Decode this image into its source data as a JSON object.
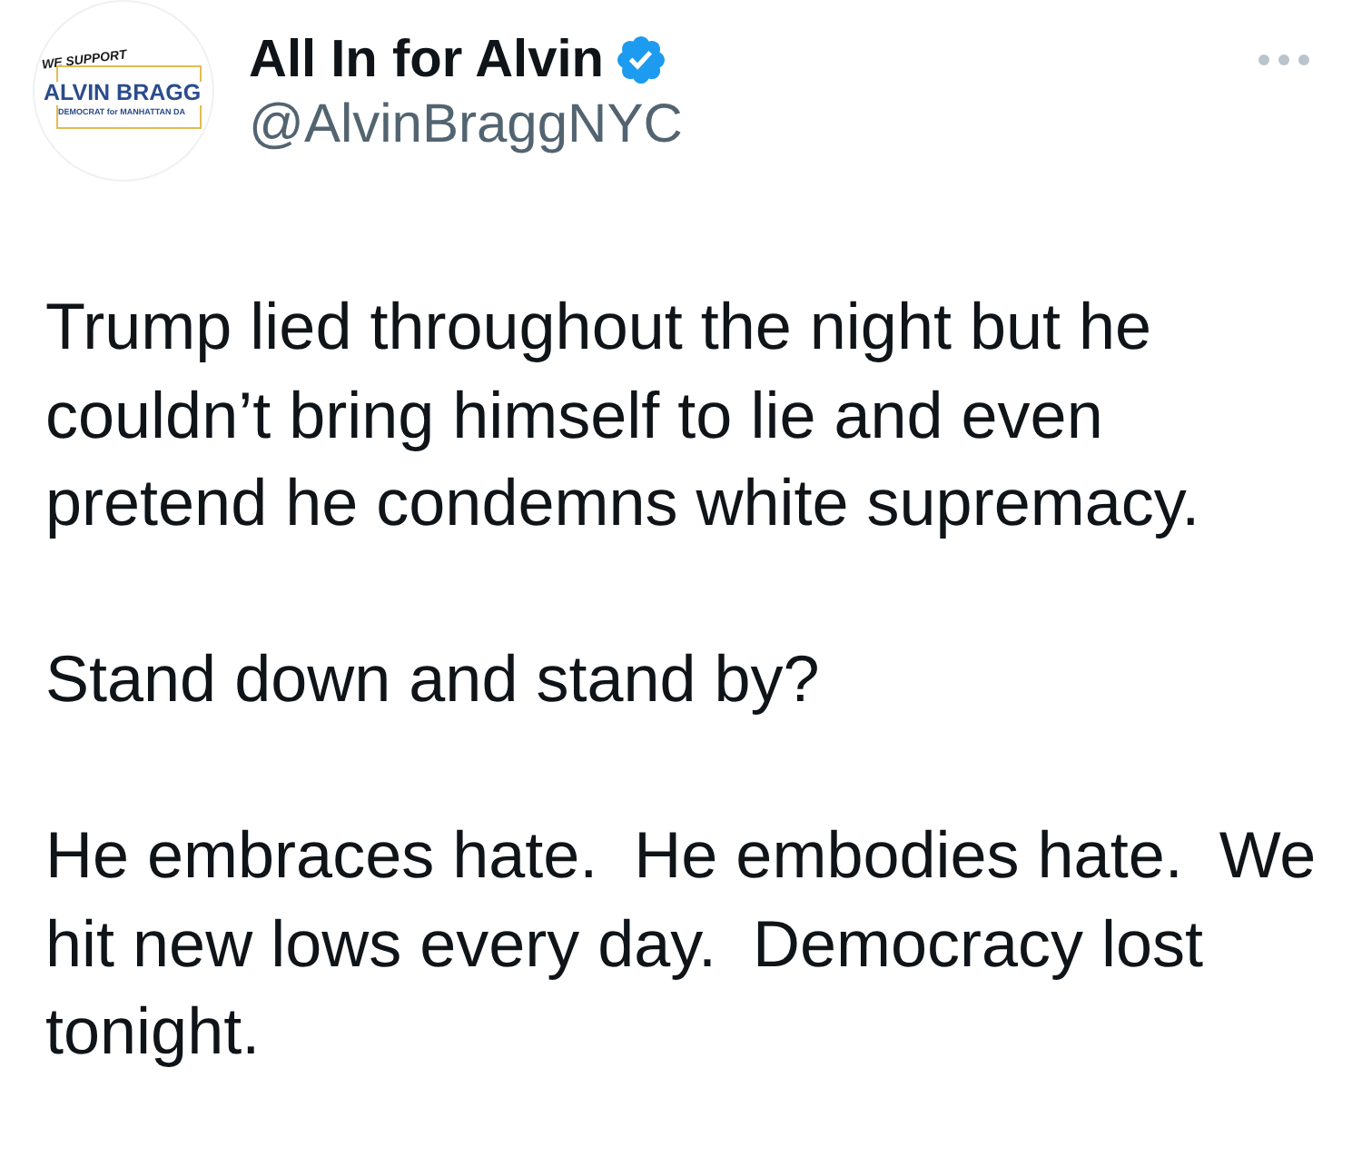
{
  "tweet": {
    "avatar": {
      "tagline": "WE SUPPORT",
      "name": "ALVIN BRAGG",
      "subtitle": "DEMOCRAT for MANHATTAN DA"
    },
    "display_name": "All In for Alvin",
    "verified": true,
    "handle": "@AlvinBraggNYC",
    "paragraphs": [
      "Trump lied throughout the night but he couldn’t bring himself to lie and even pretend he condemns white supremacy.",
      "Stand down and stand by?",
      "He embraces hate.  He embodies hate.  We hit new lows every day.  Democracy lost tonight."
    ]
  }
}
